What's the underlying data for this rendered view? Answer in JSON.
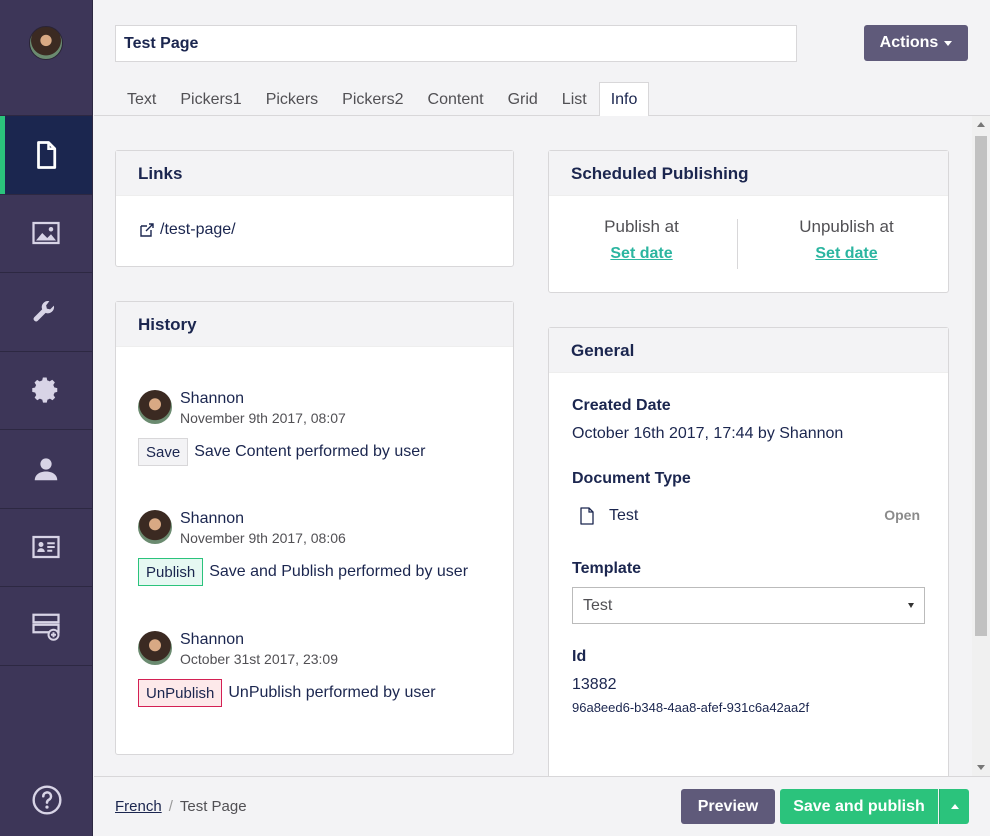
{
  "header": {
    "page_title_value": "Test Page",
    "actions_label": "Actions"
  },
  "tabs": [
    {
      "label": "Text"
    },
    {
      "label": "Pickers1"
    },
    {
      "label": "Pickers"
    },
    {
      "label": "Pickers2"
    },
    {
      "label": "Content"
    },
    {
      "label": "Grid"
    },
    {
      "label": "List"
    },
    {
      "label": "Info",
      "active": true
    }
  ],
  "sidebar": {
    "items": [
      {
        "name": "content",
        "icon": "document-icon",
        "active": true
      },
      {
        "name": "media",
        "icon": "image-icon"
      },
      {
        "name": "settings",
        "icon": "wrench-icon"
      },
      {
        "name": "developer",
        "icon": "gear-icon"
      },
      {
        "name": "users",
        "icon": "user-icon"
      },
      {
        "name": "members",
        "icon": "id-card-icon"
      },
      {
        "name": "forms",
        "icon": "form-add-icon"
      }
    ],
    "help_icon": "help-icon"
  },
  "links": {
    "title": "Links",
    "url": "/test-page/"
  },
  "history": {
    "title": "History",
    "items": [
      {
        "user": "Shannon",
        "date": "November 9th 2017, 08:07",
        "badge": "Save",
        "badge_type": "save",
        "text": "Save Content performed by user"
      },
      {
        "user": "Shannon",
        "date": "November 9th 2017, 08:06",
        "badge": "Publish",
        "badge_type": "publish",
        "text": "Save and Publish performed by user"
      },
      {
        "user": "Shannon",
        "date": "October 31st 2017, 23:09",
        "badge": "UnPublish",
        "badge_type": "unpublish",
        "text": "UnPublish performed by user"
      }
    ]
  },
  "scheduled": {
    "title": "Scheduled Publishing",
    "publish_label": "Publish at",
    "publish_link": "Set date",
    "unpublish_label": "Unpublish at",
    "unpublish_link": "Set date"
  },
  "general": {
    "title": "General",
    "created_label": "Created Date",
    "created_value": "October 16th 2017, 17:44 by Shannon",
    "doctype_label": "Document Type",
    "doctype_value": "Test",
    "open_label": "Open",
    "template_label": "Template",
    "template_value": "Test",
    "id_label": "Id",
    "id_value": "13882",
    "guid_value": "96a8eed6-b348-4aa8-afef-931c6a42aa2f"
  },
  "footer": {
    "breadcrumb": [
      "French",
      "Test Page"
    ],
    "breadcrumb_sep": "/",
    "preview_label": "Preview",
    "save_publish_label": "Save and publish"
  },
  "colors": {
    "sidebar_bg": "#3d3658",
    "active_nav": "#1b264f",
    "accent_green": "#2bc37c",
    "link_teal": "#2bb5a0",
    "button_purple": "#5f5a7a"
  }
}
